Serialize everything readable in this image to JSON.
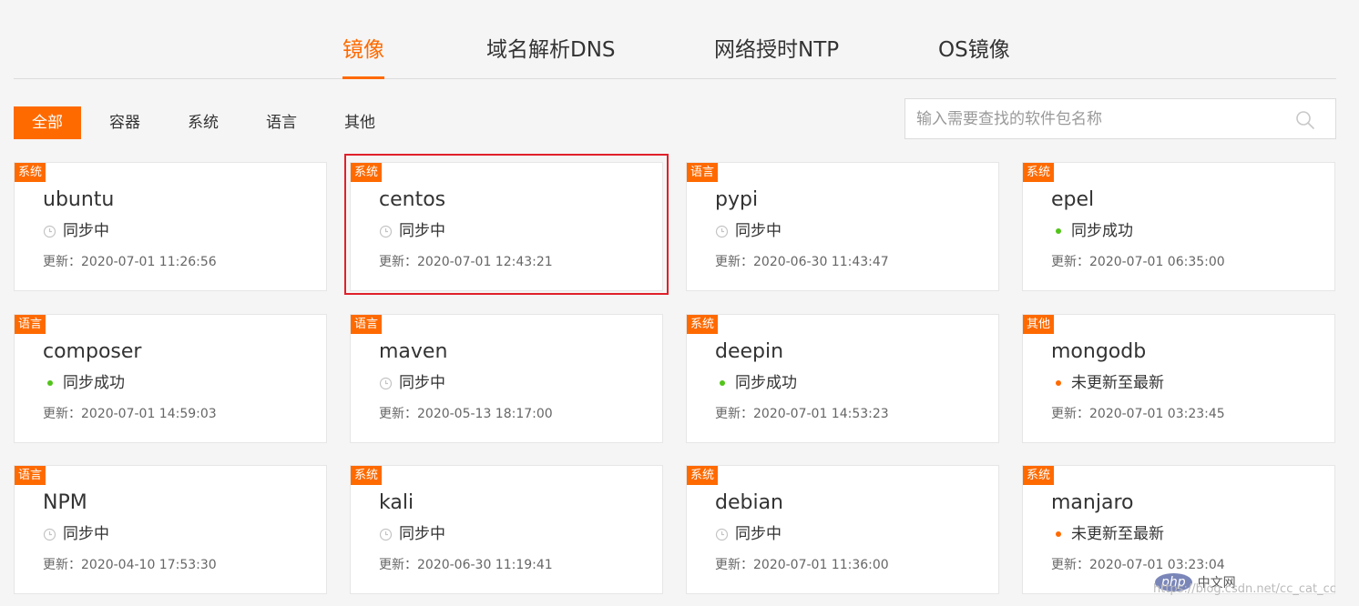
{
  "tabs": [
    {
      "label": "镜像",
      "active": true
    },
    {
      "label": "域名解析DNS",
      "active": false
    },
    {
      "label": "网络授时NTP",
      "active": false
    },
    {
      "label": "OS镜像",
      "active": false
    }
  ],
  "filters": [
    {
      "label": "全部",
      "active": true
    },
    {
      "label": "容器",
      "active": false
    },
    {
      "label": "系统",
      "active": false
    },
    {
      "label": "语言",
      "active": false
    },
    {
      "label": "其他",
      "active": false
    }
  ],
  "search": {
    "placeholder": "输入需要查找的软件包名称",
    "value": "",
    "icon": "search-icon"
  },
  "colors": {
    "accent": "#ff6a00",
    "success": "#52c41a",
    "warning": "#ff6a00",
    "highlight": "#e0202a"
  },
  "updated_prefix": "更新：",
  "cards": [
    {
      "tag": "系统",
      "name": "ubuntu",
      "status": "同步中",
      "status_type": "syncing",
      "updated": "2020-07-01 11:26:56"
    },
    {
      "tag": "系统",
      "name": "centos",
      "status": "同步中",
      "status_type": "syncing",
      "updated": "2020-07-01 12:43:21",
      "highlighted": true
    },
    {
      "tag": "语言",
      "name": "pypi",
      "status": "同步中",
      "status_type": "syncing",
      "updated": "2020-06-30 11:43:47"
    },
    {
      "tag": "系统",
      "name": "epel",
      "status": "同步成功",
      "status_type": "success",
      "updated": "2020-07-01 06:35:00"
    },
    {
      "tag": "语言",
      "name": "composer",
      "status": "同步成功",
      "status_type": "success",
      "updated": "2020-07-01 14:59:03"
    },
    {
      "tag": "语言",
      "name": "maven",
      "status": "同步中",
      "status_type": "syncing",
      "updated": "2020-05-13 18:17:00"
    },
    {
      "tag": "系统",
      "name": "deepin",
      "status": "同步成功",
      "status_type": "success",
      "updated": "2020-07-01 14:53:23"
    },
    {
      "tag": "其他",
      "name": "mongodb",
      "status": "未更新至最新",
      "status_type": "outdated",
      "updated": "2020-07-01 03:23:45"
    },
    {
      "tag": "语言",
      "name": "NPM",
      "status": "同步中",
      "status_type": "syncing",
      "updated": "2020-04-10 17:53:30"
    },
    {
      "tag": "系统",
      "name": "kali",
      "status": "同步中",
      "status_type": "syncing",
      "updated": "2020-06-30 11:19:41"
    },
    {
      "tag": "系统",
      "name": "debian",
      "status": "同步中",
      "status_type": "syncing",
      "updated": "2020-07-01 11:36:00"
    },
    {
      "tag": "系统",
      "name": "manjaro",
      "status": "未更新至最新",
      "status_type": "outdated",
      "updated": "2020-07-01 03:23:04"
    }
  ],
  "watermark": {
    "logo": "php",
    "text": "中文网",
    "url": "https://blog.csdn.net/cc_cat_cc"
  }
}
